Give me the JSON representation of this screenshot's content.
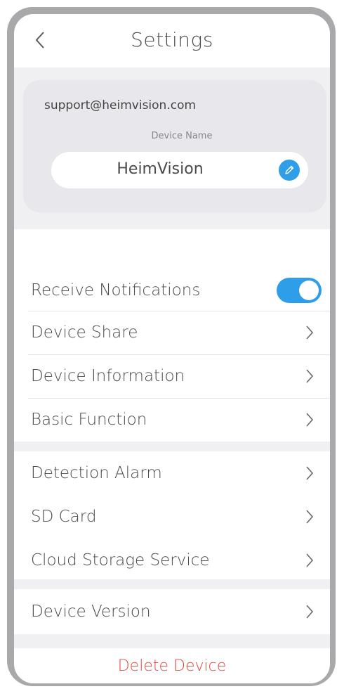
{
  "header": {
    "title": "Settings",
    "back_icon": "chevron-left-icon"
  },
  "device_card": {
    "account_email": "support@heimvision.com",
    "device_name_label": "Device Name",
    "device_name_value": "HeimVision",
    "edit_icon": "pencil-icon"
  },
  "groups": [
    {
      "items": [
        {
          "label": "Receive Notifications",
          "control": "toggle",
          "toggle_on": true
        },
        {
          "label": "Device Share",
          "control": "chevron"
        },
        {
          "label": "Device Information",
          "control": "chevron"
        },
        {
          "label": "Basic Function",
          "control": "chevron"
        }
      ]
    },
    {
      "items": [
        {
          "label": "Detection Alarm",
          "control": "chevron"
        },
        {
          "label": "SD Card",
          "control": "chevron"
        },
        {
          "label": "Cloud Storage Service",
          "control": "chevron"
        }
      ]
    },
    {
      "items": [
        {
          "label": "Device Version",
          "control": "chevron"
        }
      ]
    }
  ],
  "delete_label": "Delete Device",
  "colors": {
    "accent": "#2f9ee8",
    "danger": "#e0473e",
    "page_background": "#f0f0f2",
    "card_background": "#e8e8ec",
    "frame": "#a9a9ab"
  }
}
